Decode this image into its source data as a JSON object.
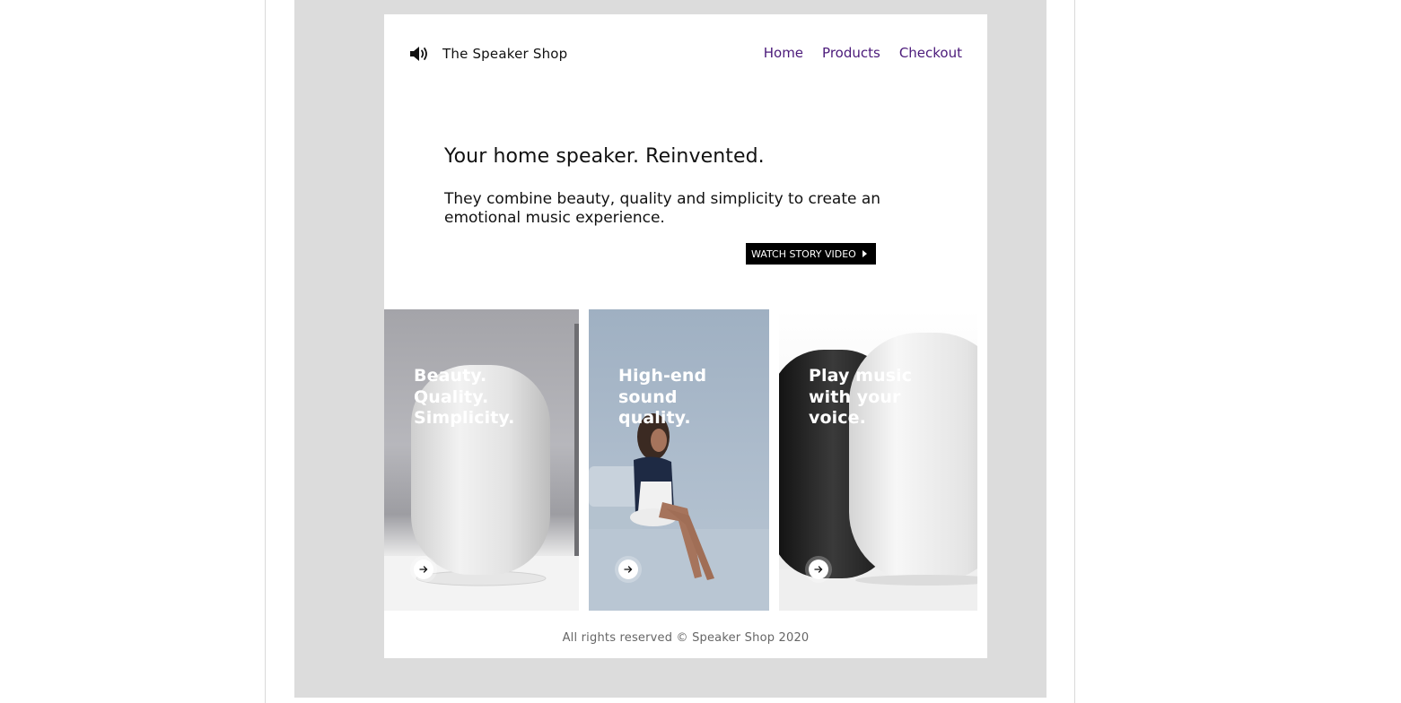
{
  "brand": {
    "name": "The Speaker Shop",
    "icon": "speaker-icon"
  },
  "nav": {
    "items": [
      "Home",
      "Products",
      "Checkout"
    ]
  },
  "hero": {
    "title": "Your home speaker. Reinvented.",
    "subtitle": "They combine beauty, quality and simplicity to create an emotional music experience.",
    "cta_label": "WATCH STORY VIDEO"
  },
  "cards": [
    {
      "title_lines": [
        "Beauty.",
        "Quality.",
        "Simplicity."
      ],
      "icon": "arrow-right-icon"
    },
    {
      "title_lines": [
        "High-end",
        "sound",
        "quality."
      ],
      "icon": "arrow-right-icon"
    },
    {
      "title_lines": [
        "Play music",
        "with your",
        "voice."
      ],
      "icon": "arrow-right-icon"
    }
  ],
  "footer": {
    "text": "All rights reserved © Speaker Shop 2020"
  },
  "colors": {
    "nav_link": "#4b1a7a",
    "canvas_gray": "#dcdcdc",
    "cta_background": "#000000"
  }
}
